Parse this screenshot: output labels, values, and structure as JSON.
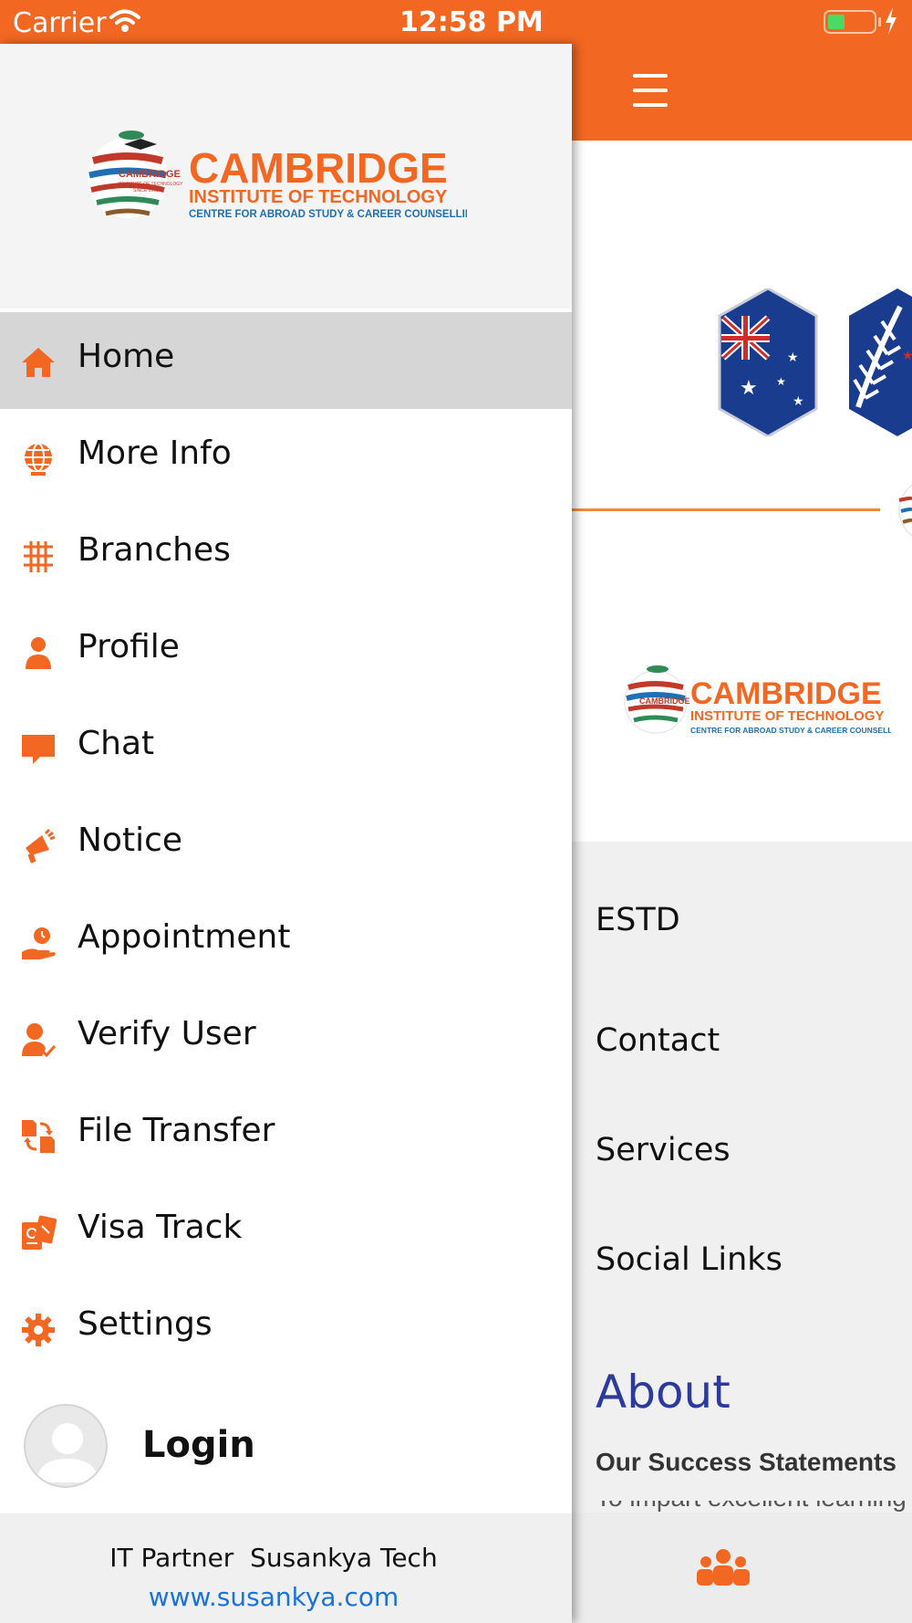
{
  "status_bar": {
    "carrier": "Carrier",
    "time": "12:58 PM",
    "battery_level": 0.3,
    "charging": true
  },
  "brand": {
    "name": "CAMBRIDGE",
    "subtitle": "INSTITUTE OF TECHNOLOGY",
    "tagline": "CENTRE FOR ABROAD STUDY & CAREER COUNSELLING",
    "globe_text": "CAMBRIDGE",
    "globe_sub": "INSTITUTE OF TECHNOLOGY",
    "globe_since": "SINCE 2011"
  },
  "drawer": {
    "menu": [
      {
        "label": "Home",
        "icon": "home-icon",
        "active": true
      },
      {
        "label": "More Info",
        "icon": "globe-icon",
        "active": false
      },
      {
        "label": "Branches",
        "icon": "branches-icon",
        "active": false
      },
      {
        "label": "Profile",
        "icon": "user-icon",
        "active": false
      },
      {
        "label": "Chat",
        "icon": "chat-icon",
        "active": false
      },
      {
        "label": "Notice",
        "icon": "megaphone-icon",
        "active": false
      },
      {
        "label": "Appointment",
        "icon": "appointment-icon",
        "active": false
      },
      {
        "label": "Verify User",
        "icon": "verify-user-icon",
        "active": false
      },
      {
        "label": "File Transfer",
        "icon": "file-transfer-icon",
        "active": false
      },
      {
        "label": "Visa Track",
        "icon": "passport-icon",
        "active": false
      },
      {
        "label": "Settings",
        "icon": "gear-icon",
        "active": false
      }
    ],
    "login_label": "Login",
    "footer": {
      "partner_text": "IT Partner  Susankya Tech",
      "link": "www.susankya.com"
    }
  },
  "main": {
    "items": [
      "ESTD",
      "Contact",
      "Services",
      "Social Links"
    ],
    "about_heading": "About",
    "success_heading": "Our Success Statements",
    "cut_text": "To impart excellent learning"
  },
  "colors": {
    "accent": "#f26722",
    "active_row": "#d6d6d6",
    "link": "#1a73d6",
    "about": "#2b3a9b"
  }
}
